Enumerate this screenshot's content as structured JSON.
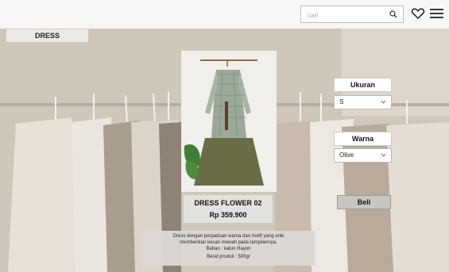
{
  "header": {
    "search": {
      "placeholder": "cari",
      "icon": "search-icon"
    },
    "icons": [
      "heart-icon",
      "menu-icon"
    ]
  },
  "category": {
    "label": "DRESS"
  },
  "product": {
    "name": "DRESS FLOWER 02",
    "price": "Rp 359.900",
    "image": "dress-photo"
  },
  "options": {
    "size": {
      "label": "Ukuran",
      "selected": "S"
    },
    "color": {
      "label": "Warna",
      "selected": "Olive"
    }
  },
  "actions": {
    "buy_label": "Beli"
  },
  "description": {
    "line1": "Dress dengan perpaduan warna dan motif yang unik",
    "line2": "memberikan kesan mewah pada tampilannya.",
    "line3": "Bahan : katun Rayon",
    "line4": "Berat produk : 500gr"
  },
  "colors": {
    "header_bg": "#f7f7f5",
    "hero_bg": "#cfc5b8",
    "tab_bg": "#ebe9e6",
    "button_bg": "#c8c6c2"
  }
}
